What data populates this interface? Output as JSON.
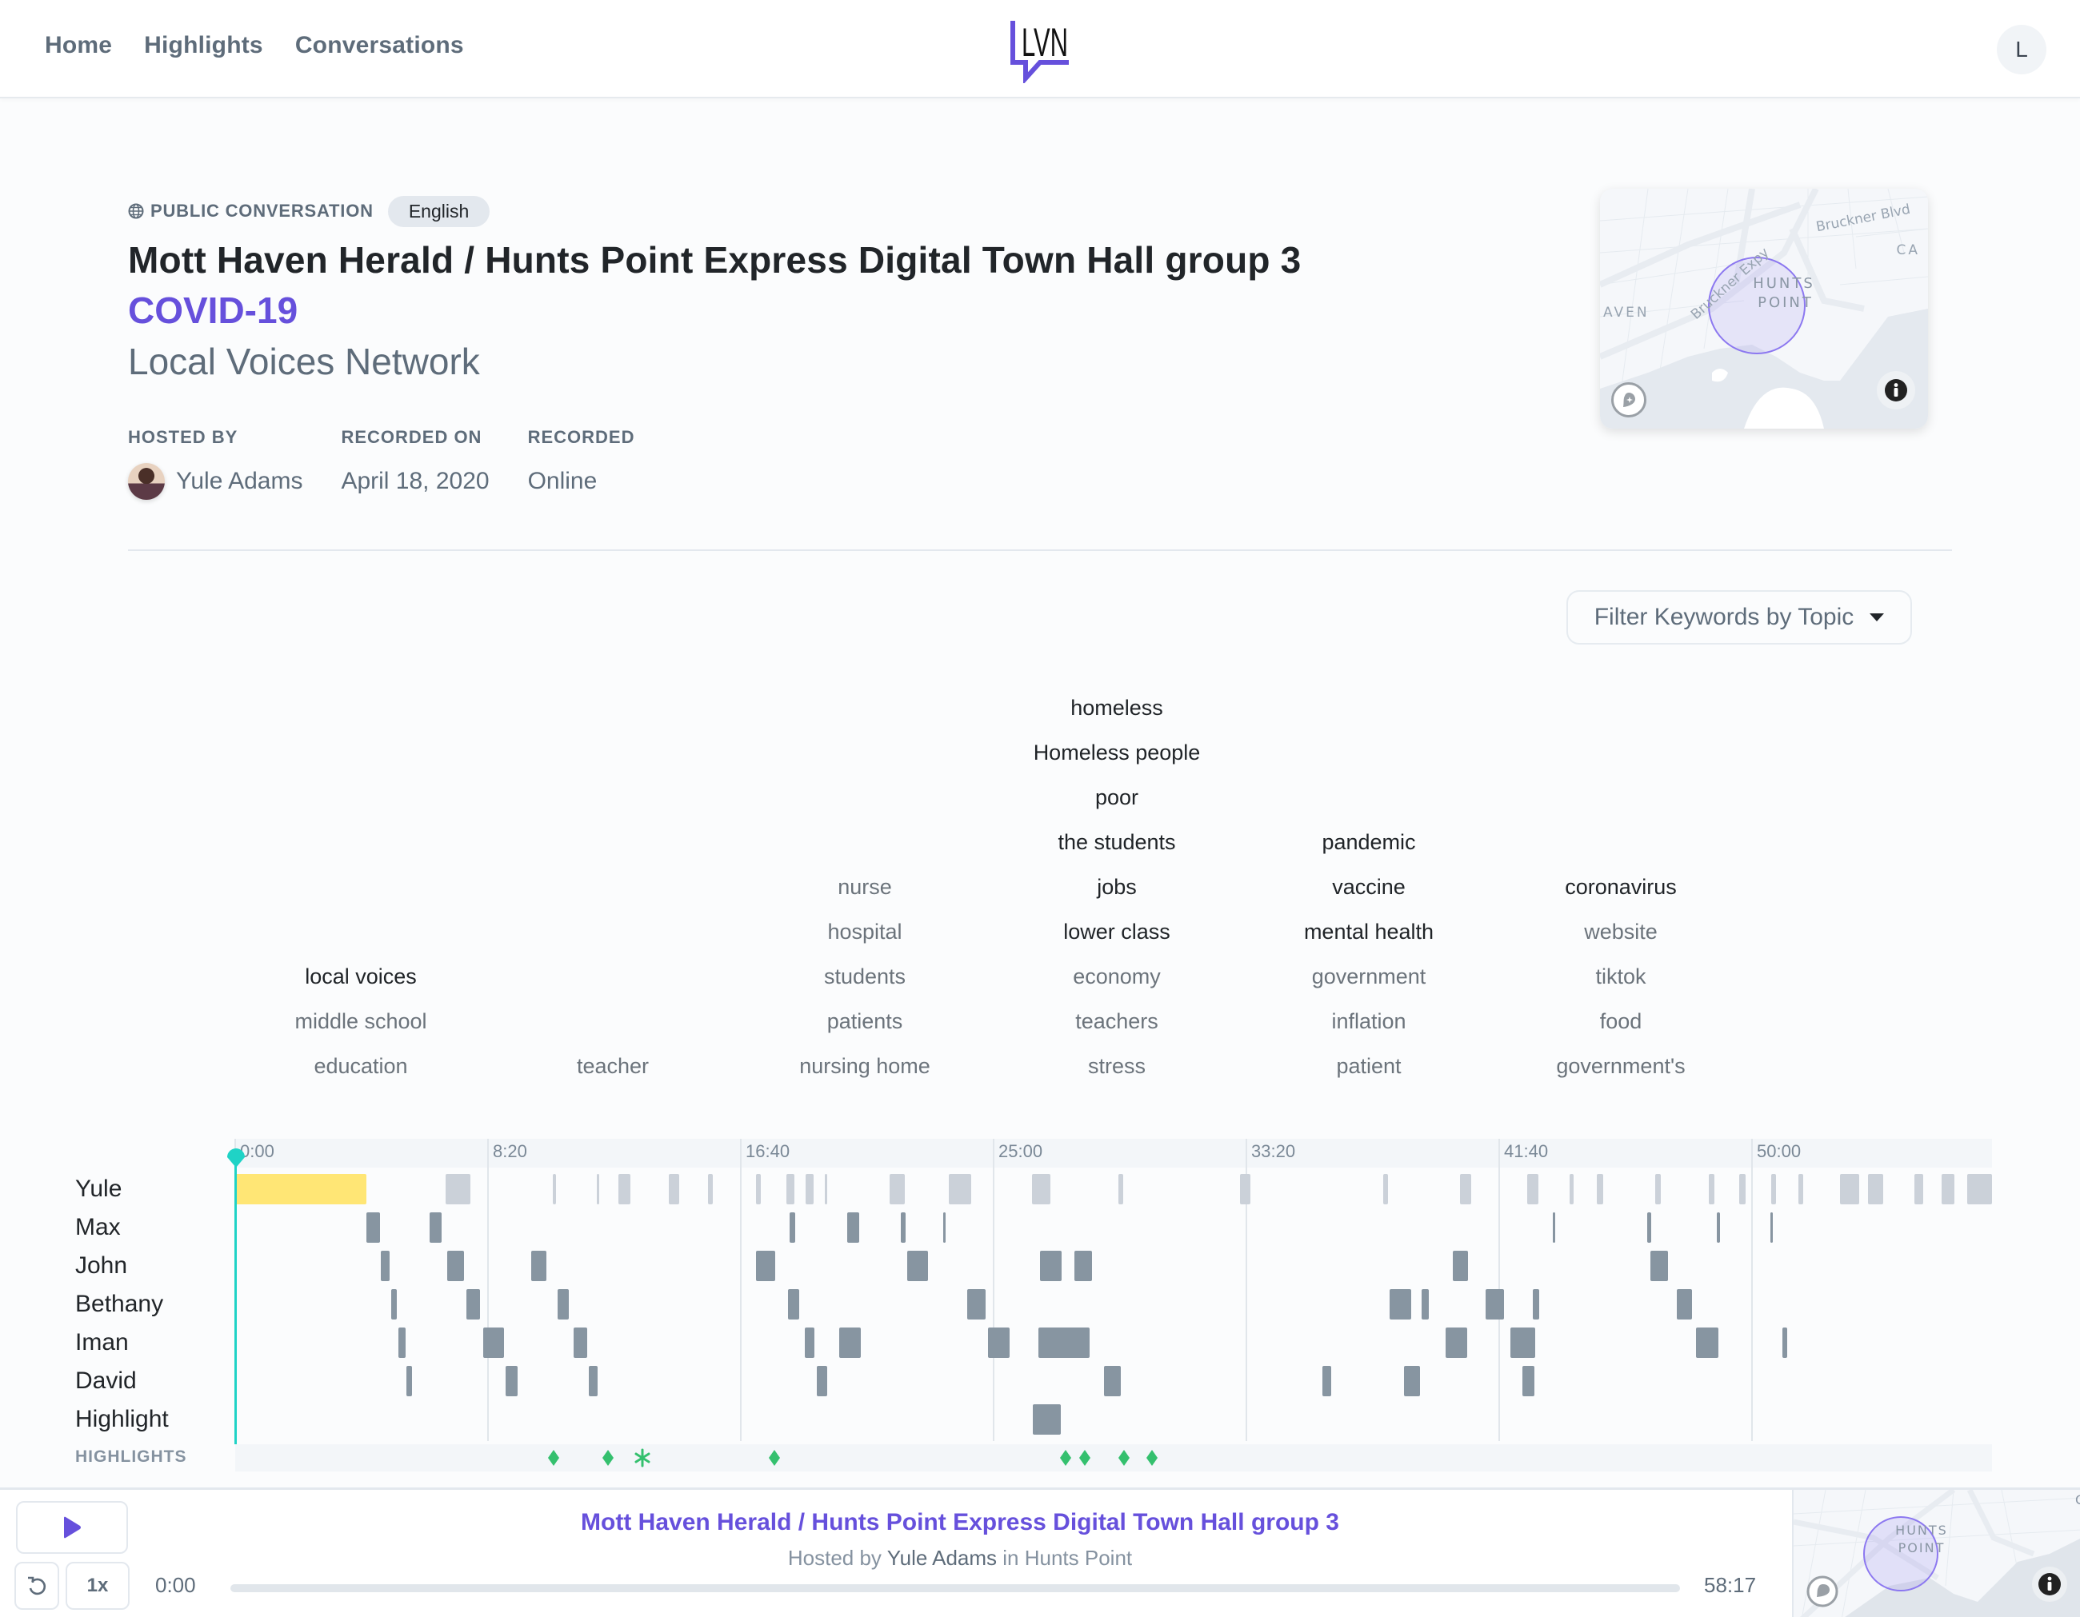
{
  "nav": {
    "links": [
      "Home",
      "Highlights",
      "Conversations"
    ],
    "logo_text": "LVN",
    "user_initial": "L"
  },
  "conversation": {
    "visibility_icon": "globe-icon",
    "visibility": "PUBLIC CONVERSATION",
    "language": "English",
    "title": "Mott Haven Herald / Hunts Point Express Digital Town Hall group 3",
    "topic": "COVID-19",
    "collection": "Local Voices Network",
    "details": {
      "hosted_by_label": "HOSTED BY",
      "host": "Yule Adams",
      "recorded_on_label": "RECORDED ON",
      "recorded_on": "April 18, 2020",
      "recorded_label": "RECORDED",
      "recorded": "Online"
    }
  },
  "map": {
    "labels": [
      "Bruckner Blvd",
      "CA",
      "AVEN",
      "Bruckner Expy",
      "HUNTS",
      "POINT"
    ],
    "locate_icon": "map-pin-icon",
    "info_icon": "info-icon",
    "accent": "#6650dc"
  },
  "filter": {
    "label": "Filter Keywords by Topic"
  },
  "keywords": {
    "columns": [
      {
        "words": [
          {
            "text": "local voices",
            "strong": true
          },
          {
            "text": "middle school",
            "strong": false
          },
          {
            "text": "education",
            "strong": false
          }
        ]
      },
      {
        "words": [
          {
            "text": "teacher",
            "strong": false
          }
        ]
      },
      {
        "words": [
          {
            "text": "nurse",
            "strong": false
          },
          {
            "text": "hospital",
            "strong": false
          },
          {
            "text": "students",
            "strong": false
          },
          {
            "text": "patients",
            "strong": false
          },
          {
            "text": "nursing home",
            "strong": false
          }
        ]
      },
      {
        "words": [
          {
            "text": "homeless",
            "strong": true
          },
          {
            "text": "Homeless people",
            "strong": true
          },
          {
            "text": "poor",
            "strong": true
          },
          {
            "text": "the students",
            "strong": true
          },
          {
            "text": "jobs",
            "strong": true
          },
          {
            "text": "lower class",
            "strong": true
          },
          {
            "text": "economy",
            "strong": false
          },
          {
            "text": "teachers",
            "strong": false
          },
          {
            "text": "stress",
            "strong": false
          }
        ]
      },
      {
        "words": [
          {
            "text": "pandemic",
            "strong": true
          },
          {
            "text": "vaccine",
            "strong": true
          },
          {
            "text": "mental health",
            "strong": true
          },
          {
            "text": "government",
            "strong": false
          },
          {
            "text": "inflation",
            "strong": false
          },
          {
            "text": "patient",
            "strong": false
          }
        ]
      },
      {
        "words": [
          {
            "text": "coronavirus",
            "strong": true
          },
          {
            "text": "website",
            "strong": false
          },
          {
            "text": "tiktok",
            "strong": false
          },
          {
            "text": "food",
            "strong": false
          },
          {
            "text": "government's",
            "strong": false
          }
        ]
      }
    ]
  },
  "timeline": {
    "duration_seconds": 3497,
    "tick_labels": [
      "0:00",
      "8:20",
      "16:40",
      "25:00",
      "33:20",
      "41:40",
      "50:00"
    ],
    "tick_seconds": [
      0,
      500,
      1000,
      1500,
      2000,
      2500,
      3000
    ],
    "playhead_seconds": 0,
    "colors": {
      "host": "#cbd1d9",
      "participant": "#8795a1",
      "active": "#ffe675",
      "playhead": "#1fd3c6",
      "highlight": "#34c06e"
    },
    "speakers": [
      {
        "name": "Yule",
        "segments": [
          [
            0,
            259,
            "active"
          ],
          [
            416,
            465
          ],
          [
            628,
            635
          ],
          [
            715,
            720
          ],
          [
            758,
            782
          ],
          [
            858,
            878
          ],
          [
            935,
            945
          ],
          [
            1030,
            1040
          ],
          [
            1090,
            1106
          ],
          [
            1128,
            1144
          ],
          [
            1166,
            1171
          ],
          [
            1294,
            1324
          ],
          [
            1411,
            1456
          ],
          [
            1576,
            1612
          ],
          [
            1747,
            1756
          ],
          [
            1987,
            2008
          ],
          [
            2270,
            2280
          ],
          [
            2422,
            2445
          ],
          [
            2555,
            2577
          ],
          [
            2639,
            2647
          ],
          [
            2693,
            2706
          ],
          [
            2809,
            2820
          ],
          [
            2915,
            2926
          ],
          [
            2975,
            2987
          ],
          [
            3038,
            3048
          ],
          [
            3092,
            3101
          ],
          [
            3174,
            3212
          ],
          [
            3229,
            3259
          ],
          [
            3321,
            3339
          ],
          [
            3375,
            3400
          ],
          [
            3425,
            3475
          ]
        ]
      },
      {
        "name": "Max",
        "segments": [
          [
            259,
            286
          ],
          [
            384,
            409
          ],
          [
            1097,
            1108
          ],
          [
            1211,
            1234
          ],
          [
            1317,
            1326
          ],
          [
            1401,
            1405
          ],
          [
            2606,
            2610
          ],
          [
            2792,
            2801
          ],
          [
            2930,
            2937
          ],
          [
            3036,
            3039
          ]
        ]
      },
      {
        "name": "John",
        "segments": [
          [
            288,
            306
          ],
          [
            420,
            453
          ],
          [
            585,
            615
          ],
          [
            1030,
            1068
          ],
          [
            1329,
            1370
          ],
          [
            1592,
            1634
          ],
          [
            1660,
            1694
          ],
          [
            2408,
            2438
          ],
          [
            2799,
            2834
          ]
        ]
      },
      {
        "name": "Bethany",
        "segments": [
          [
            308,
            320
          ],
          [
            457,
            484
          ],
          [
            638,
            660
          ],
          [
            1094,
            1116
          ],
          [
            1447,
            1484
          ],
          [
            2283,
            2326
          ],
          [
            2347,
            2360
          ],
          [
            2473,
            2510
          ],
          [
            2567,
            2579
          ],
          [
            2851,
            2881
          ]
        ]
      },
      {
        "name": "Iman",
        "segments": [
          [
            322,
            337
          ],
          [
            490,
            531
          ],
          [
            670,
            696
          ],
          [
            1127,
            1145
          ],
          [
            1194,
            1238
          ],
          [
            1489,
            1532
          ],
          [
            1588,
            1690
          ],
          [
            2394,
            2436
          ],
          [
            2522,
            2571
          ],
          [
            2889,
            2934
          ],
          [
            3060,
            3070
          ]
        ]
      },
      {
        "name": "David",
        "segments": [
          [
            339,
            350
          ],
          [
            535,
            558
          ],
          [
            699,
            716
          ],
          [
            1150,
            1171
          ],
          [
            1718,
            1751
          ],
          [
            2150,
            2168
          ],
          [
            2311,
            2344
          ],
          [
            2546,
            2569
          ]
        ]
      },
      {
        "name": "Highlight",
        "segments": [
          [
            1578,
            1633
          ]
        ]
      }
    ],
    "highlights_label": "HIGHLIGHTS",
    "highlight_markers": [
      {
        "seconds": 630,
        "shape": "diamond"
      },
      {
        "seconds": 737,
        "shape": "diamond"
      },
      {
        "seconds": 805,
        "shape": "asterisk"
      },
      {
        "seconds": 1066,
        "shape": "diamond"
      },
      {
        "seconds": 1642,
        "shape": "diamond"
      },
      {
        "seconds": 1680,
        "shape": "diamond"
      },
      {
        "seconds": 1758,
        "shape": "diamond"
      },
      {
        "seconds": 1814,
        "shape": "diamond"
      }
    ]
  },
  "player": {
    "play_icon": "play-icon",
    "rewind_icon": "rewind-icon",
    "speed": "1x",
    "current_time": "0:00",
    "total_time": "58:17",
    "progress": 0,
    "title": "Mott Haven Herald / Hunts Point Express Digital Town Hall group 3",
    "hosted_by_prefix": "Hosted by",
    "host": "Yule Adams",
    "location_prefix": "in",
    "location": "Hunts Point",
    "map_labels": [
      "HUNTS",
      "POINT",
      "C"
    ]
  }
}
